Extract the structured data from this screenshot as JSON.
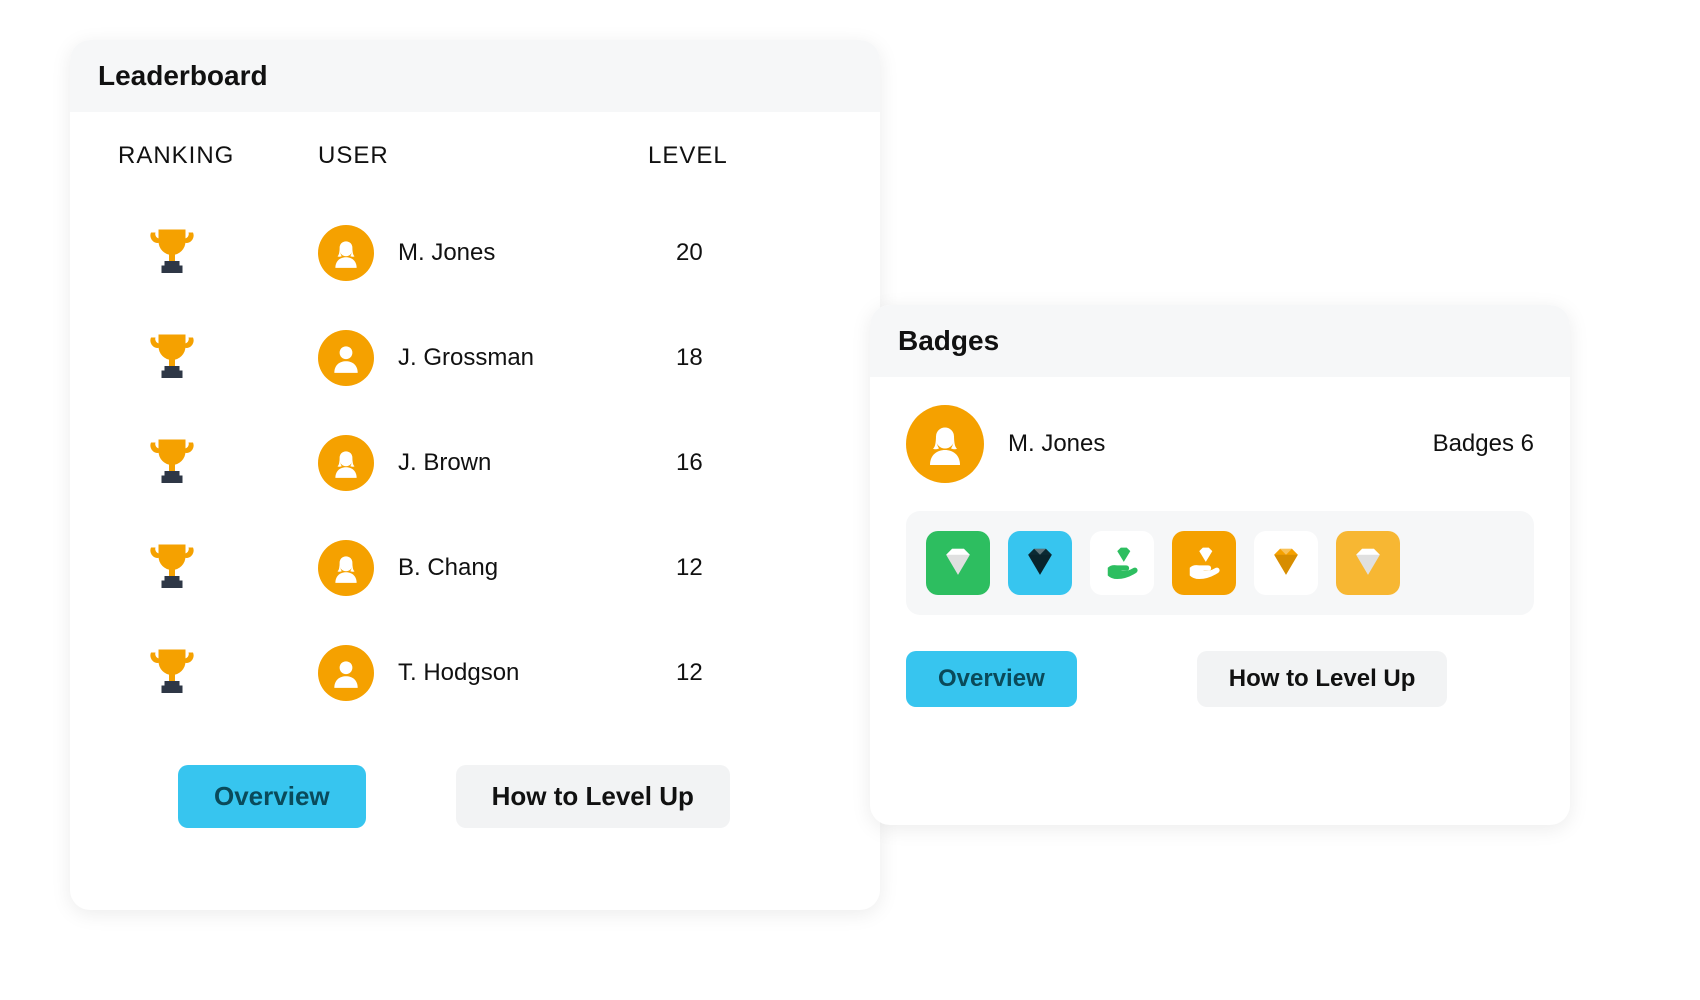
{
  "colors": {
    "accent": "#37c5ef",
    "avatar_bg": "#f5a100",
    "trophy_cup": "#f5a100",
    "trophy_base": "#2e3746"
  },
  "leaderboard": {
    "title": "Leaderboard",
    "columns": {
      "ranking": "RANKING",
      "user": "USER",
      "level": "LEVEL"
    },
    "rows": [
      {
        "name": "M. Jones",
        "level": "20",
        "avatar": "female"
      },
      {
        "name": "J. Grossman",
        "level": "18",
        "avatar": "male"
      },
      {
        "name": "J. Brown",
        "level": "16",
        "avatar": "female"
      },
      {
        "name": "B. Chang",
        "level": "12",
        "avatar": "female"
      },
      {
        "name": "T. Hodgson",
        "level": "12",
        "avatar": "male"
      }
    ],
    "buttons": {
      "overview": "Overview",
      "level_up": "How to Level Up"
    }
  },
  "badges_card": {
    "title": "Badges",
    "user": {
      "name": "M. Jones",
      "avatar": "female"
    },
    "count_label": "Badges 6",
    "badges": [
      {
        "id": "diamond-green",
        "bg": "#2DBE60",
        "icon": "diamond",
        "icon_color": "#ffffff"
      },
      {
        "id": "diamond-blue",
        "bg": "#37c5ef",
        "icon": "diamond",
        "icon_color": "#0a2a33"
      },
      {
        "id": "hand-diamond-green",
        "bg": "#ffffff",
        "icon": "hand-diamond",
        "icon_color": "#2DBE60"
      },
      {
        "id": "hand-diamond-orange",
        "bg": "#f5a100",
        "icon": "hand-diamond",
        "icon_color": "#ffffff"
      },
      {
        "id": "diamond-outline",
        "bg": "#ffffff",
        "icon": "diamond",
        "icon_color": "#f5a100"
      },
      {
        "id": "diamond-amber",
        "bg": "#f7b733",
        "icon": "diamond",
        "icon_color": "#ffffff"
      }
    ],
    "buttons": {
      "overview": "Overview",
      "level_up": "How to Level Up"
    }
  }
}
